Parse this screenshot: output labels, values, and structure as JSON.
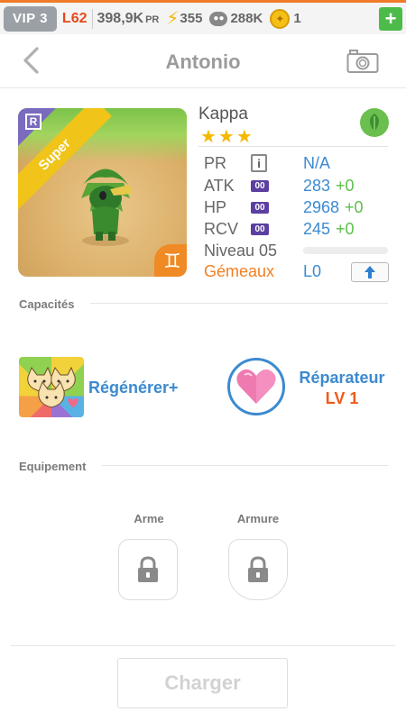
{
  "topbar": {
    "vip": "VIP 3",
    "level": "L62",
    "pr_value": "398,9K",
    "pr_unit": "PR",
    "energy": "355",
    "paw": "288K",
    "coins": "1",
    "plus": "+"
  },
  "header": {
    "title": "Antonio",
    "back_icon": "chevron-left-icon",
    "camera_icon": "camera-icon"
  },
  "card": {
    "rarity_badge": "R",
    "banner": "Super",
    "zodiac_symbol": "♊"
  },
  "monster": {
    "name": "Kappa",
    "stars": 3,
    "element_icon": "leaf-icon",
    "stats": [
      {
        "label": "PR",
        "badge": "i",
        "value": "N/A",
        "bonus": ""
      },
      {
        "label": "ATK",
        "badge": "00",
        "value": "283",
        "bonus": "+0"
      },
      {
        "label": "HP",
        "badge": "00",
        "value": "2968",
        "bonus": "+0"
      },
      {
        "label": "RCV",
        "badge": "00",
        "value": "245",
        "bonus": "+0"
      }
    ],
    "level_label": "Niveau 05",
    "level_progress": 0,
    "sign": "Gémeaux",
    "sign_level": "L0"
  },
  "abilities": {
    "section_label": "Capacités",
    "skill_name": "Régénérer+",
    "leader_name": "Réparateur",
    "leader_level": "LV 1"
  },
  "equipment": {
    "section_label": "Equipement",
    "weapon_label": "Arme",
    "armor_label": "Armure"
  },
  "footer": {
    "charger_label": "Charger"
  },
  "colors": {
    "accent_blue": "#3c8ad0",
    "accent_orange": "#f08020",
    "green": "#5cbf4a"
  }
}
